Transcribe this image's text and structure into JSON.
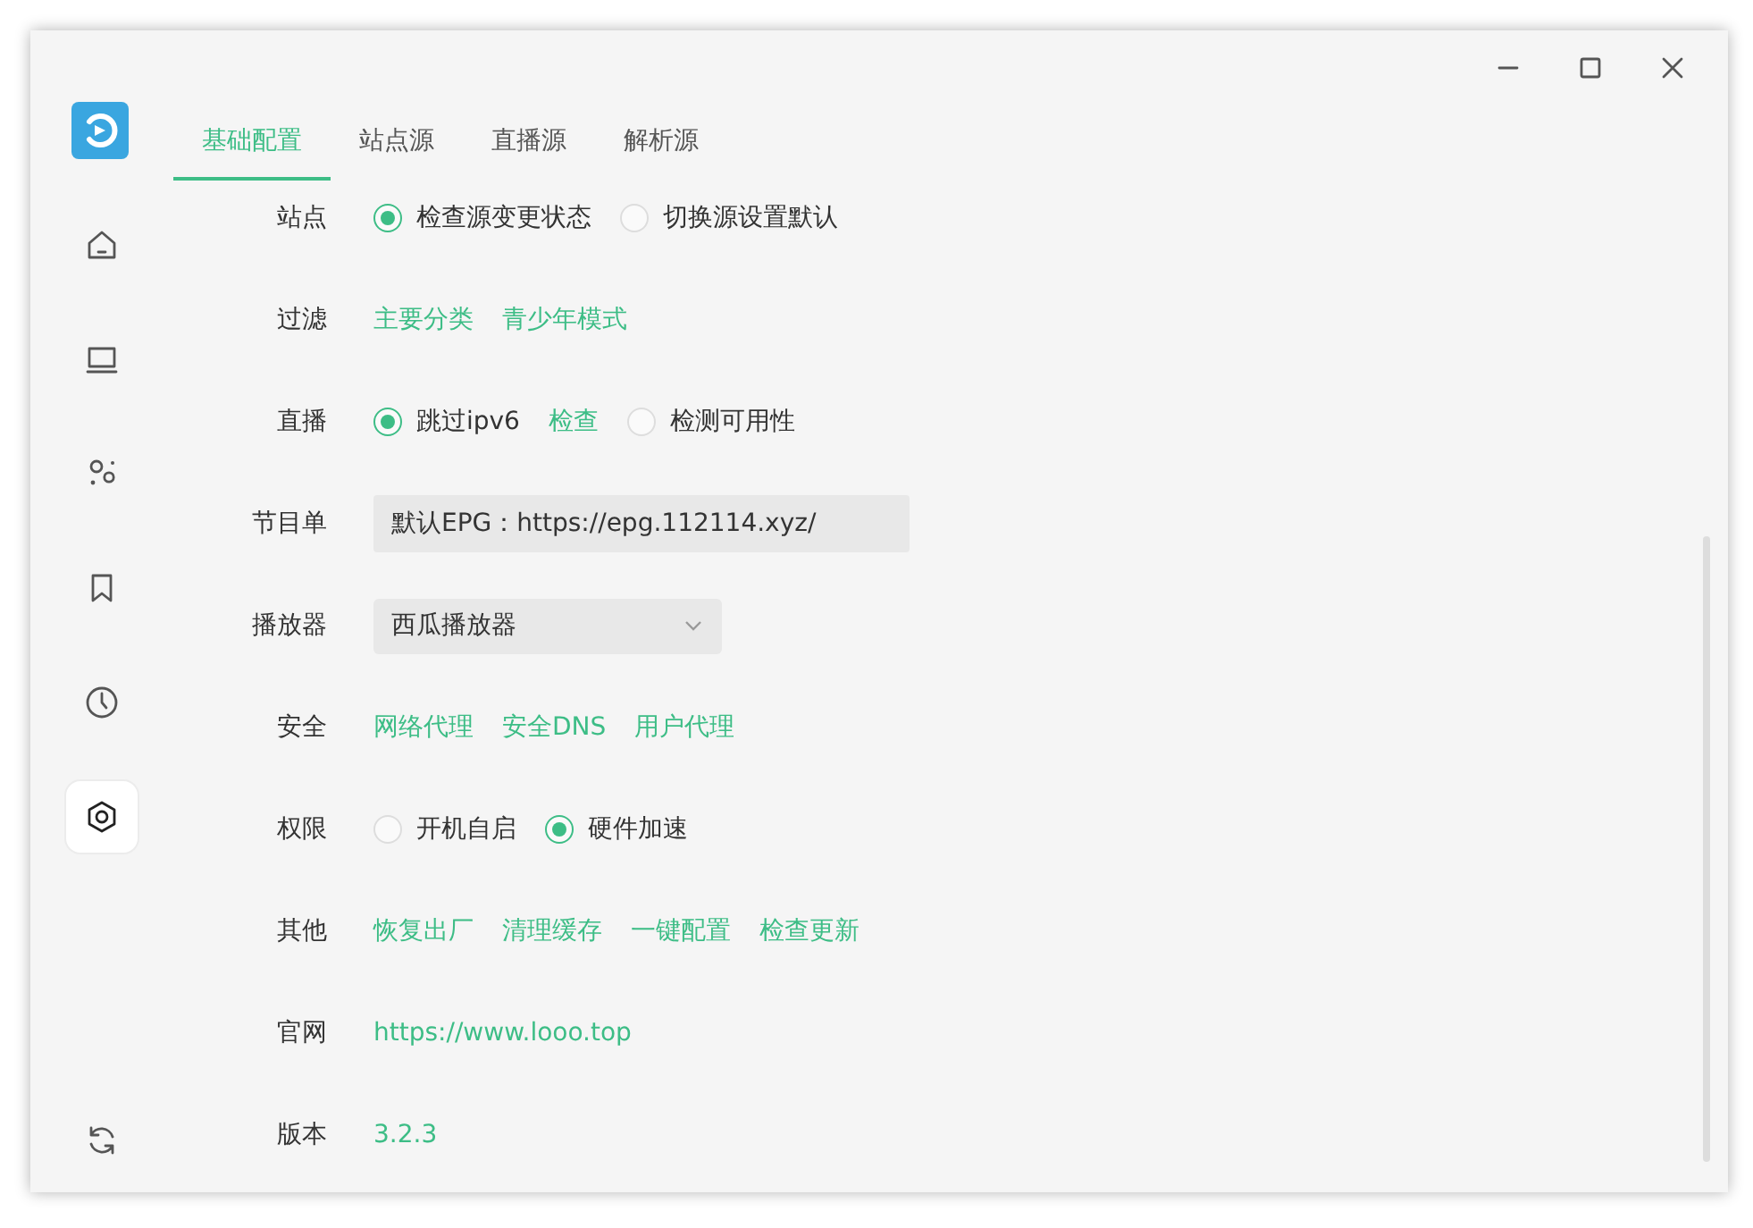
{
  "window_controls": [
    {
      "kind": "minimize"
    },
    {
      "kind": "maximize"
    },
    {
      "kind": "close"
    }
  ],
  "sidebar": {
    "items": [
      {
        "kind": "home",
        "selected": false
      },
      {
        "kind": "screen",
        "selected": false
      },
      {
        "kind": "dots",
        "selected": false
      },
      {
        "kind": "bookmark",
        "selected": false
      },
      {
        "kind": "clock",
        "selected": false
      },
      {
        "kind": "settings",
        "selected": true
      }
    ],
    "bottom": {
      "kind": "refresh"
    }
  },
  "tabs": [
    {
      "label": "基础配置",
      "selected": true
    },
    {
      "label": "站点源",
      "selected": false
    },
    {
      "label": "直播源",
      "selected": false
    },
    {
      "label": "解析源",
      "selected": false
    }
  ],
  "settings": [
    {
      "label": "站点",
      "items": [
        {
          "kind": "radio",
          "label": "检查源变更状态",
          "selected": true
        },
        {
          "kind": "radio",
          "label": "切换源设置默认",
          "selected": false
        }
      ]
    },
    {
      "label": "过滤",
      "items": [
        {
          "kind": "link",
          "label": "主要分类"
        },
        {
          "kind": "link",
          "label": "青少年模式"
        }
      ]
    },
    {
      "label": "直播",
      "items": [
        {
          "kind": "radio",
          "label": "跳过ipv6",
          "selected": true
        },
        {
          "kind": "link",
          "label": "检查"
        },
        {
          "kind": "radio",
          "label": "检测可用性",
          "selected": false
        }
      ]
    },
    {
      "label": "节目单",
      "items": [
        {
          "kind": "field",
          "value": "默认EPG：https://epg.112114.xyz/"
        }
      ]
    },
    {
      "label": "播放器",
      "items": [
        {
          "kind": "select",
          "value": "西瓜播放器"
        }
      ]
    },
    {
      "label": "安全",
      "items": [
        {
          "kind": "link",
          "label": "网络代理"
        },
        {
          "kind": "link",
          "label": "安全DNS"
        },
        {
          "kind": "link",
          "label": "用户代理"
        }
      ]
    },
    {
      "label": "权限",
      "items": [
        {
          "kind": "radio",
          "label": "开机自启",
          "selected": false
        },
        {
          "kind": "radio",
          "label": "硬件加速",
          "selected": true
        }
      ]
    },
    {
      "label": "其他",
      "items": [
        {
          "kind": "link",
          "label": "恢复出厂"
        },
        {
          "kind": "link",
          "label": "清理缓存"
        },
        {
          "kind": "link",
          "label": "一键配置"
        },
        {
          "kind": "link",
          "label": "检查更新"
        }
      ]
    },
    {
      "label": "官网",
      "items": [
        {
          "kind": "link",
          "label": "https://www.looo.top"
        }
      ]
    },
    {
      "label": "版本",
      "items": [
        {
          "kind": "text",
          "label": "3.2.3"
        }
      ]
    }
  ]
}
